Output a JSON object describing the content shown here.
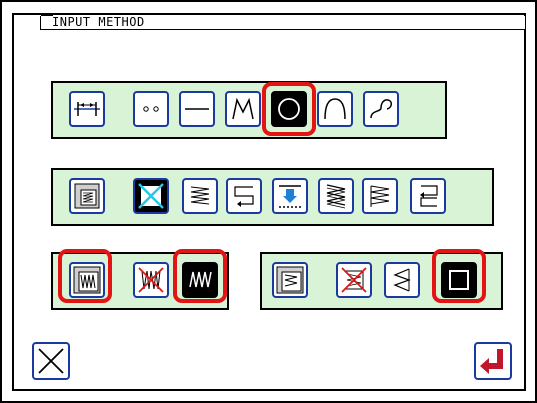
{
  "header": {
    "title": "INPUT METHOD"
  },
  "colors": {
    "panel": "#d9f3d6",
    "border": "#1b3aa0",
    "highlight": "#e31414",
    "selected": "#000000",
    "enter_arrow": "#c0152a"
  },
  "rows": {
    "row1": [
      "point-spacing-icon",
      "point-icon",
      "straight-line-icon",
      "polyline-icon",
      "circle-icon",
      "arc-icon",
      "curve-icon"
    ],
    "row2": [
      "sewing-list-icon",
      "pattern-cross-icon",
      "zigzag-stitch-icon",
      "back-tack-icon",
      "downward-arrow-icon",
      "multi-zigzag-icon",
      "step-zigzag-icon",
      "return-arrow-icon"
    ],
    "row3_left": [
      "zigzag-pattern-icon",
      "crossed-zigzag-icon",
      "zigzag-selected-icon"
    ],
    "row3_right": [
      "list-icon",
      "crossed-pattern-icon",
      "zigzag-triangle-icon",
      "square-selected-icon"
    ]
  },
  "footer": {
    "cancel_icon": "close-icon",
    "enter_icon": "enter-icon"
  }
}
